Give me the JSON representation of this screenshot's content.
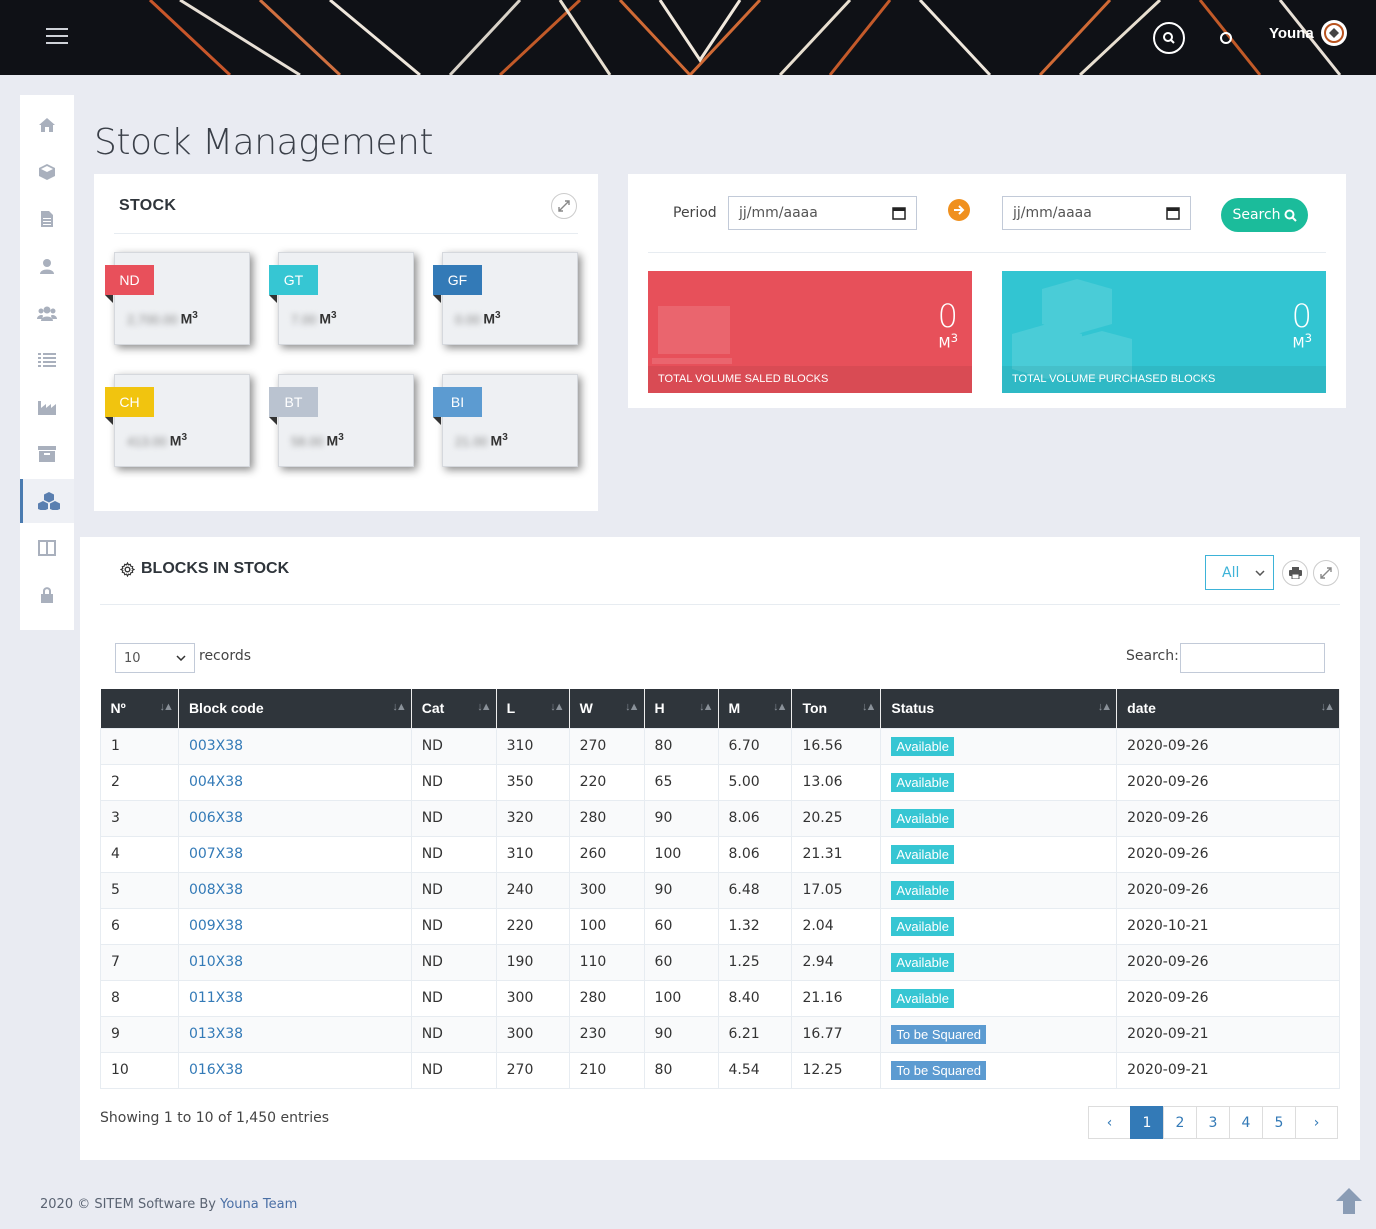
{
  "header": {
    "user_name": "Youna"
  },
  "sidebar": {
    "items": [
      {
        "icon": "home-icon"
      },
      {
        "icon": "cube-icon"
      },
      {
        "icon": "document-icon"
      },
      {
        "icon": "user-icon"
      },
      {
        "icon": "users-icon"
      },
      {
        "icon": "list-icon"
      },
      {
        "icon": "factory-icon"
      },
      {
        "icon": "archive-icon"
      },
      {
        "icon": "cubes-icon",
        "active": true
      },
      {
        "icon": "columns-icon"
      },
      {
        "icon": "lock-icon"
      }
    ]
  },
  "page_title": "Stock Management",
  "stock": {
    "title": "STOCK",
    "unit": "M",
    "cards": [
      {
        "code": "ND",
        "color": "#e8505b",
        "value": "2,700.00"
      },
      {
        "code": "GT",
        "color": "#36c6d3",
        "value": "7.00"
      },
      {
        "code": "GF",
        "color": "#337ab7",
        "value": "0.00"
      },
      {
        "code": "CH",
        "color": "#f1c40f",
        "value": "413.00"
      },
      {
        "code": "BT",
        "color": "#bac3d0",
        "value": "58.00"
      },
      {
        "code": "BI",
        "color": "#5c9bd1",
        "value": "21.00"
      }
    ]
  },
  "period": {
    "label": "Period",
    "from_placeholder": "jj/mm/aaaa",
    "to_placeholder": "jj/mm/aaaa",
    "search_label": "Search"
  },
  "stats": {
    "saled": {
      "value": "0",
      "unit": "M",
      "label": "TOTAL VOLUME SALED BLOCKS",
      "color": "#e7505a"
    },
    "purchased": {
      "value": "0",
      "unit": "M",
      "label": "TOTAL VOLUME PURCHASED BLOCKS",
      "color": "#32c5d2"
    }
  },
  "blocks": {
    "title": "BLOCKS IN STOCK",
    "filter_value": "All",
    "records_value": "10",
    "records_label": "records",
    "search_label": "Search:",
    "columns": [
      "Nº",
      "Block code",
      "Cat",
      "L",
      "W",
      "H",
      "M",
      "Ton",
      "Status",
      "date"
    ],
    "rows": [
      [
        "1",
        "003X38",
        "ND",
        "310",
        "270",
        "80",
        "6.70",
        "16.56",
        "Available",
        "2020-09-26"
      ],
      [
        "2",
        "004X38",
        "ND",
        "350",
        "220",
        "65",
        "5.00",
        "13.06",
        "Available",
        "2020-09-26"
      ],
      [
        "3",
        "006X38",
        "ND",
        "320",
        "280",
        "90",
        "8.06",
        "20.25",
        "Available",
        "2020-09-26"
      ],
      [
        "4",
        "007X38",
        "ND",
        "310",
        "260",
        "100",
        "8.06",
        "21.31",
        "Available",
        "2020-09-26"
      ],
      [
        "5",
        "008X38",
        "ND",
        "240",
        "300",
        "90",
        "6.48",
        "17.05",
        "Available",
        "2020-09-26"
      ],
      [
        "6",
        "009X38",
        "ND",
        "220",
        "100",
        "60",
        "1.32",
        "2.04",
        "Available",
        "2020-10-21"
      ],
      [
        "7",
        "010X38",
        "ND",
        "190",
        "110",
        "60",
        "1.25",
        "2.94",
        "Available",
        "2020-09-26"
      ],
      [
        "8",
        "011X38",
        "ND",
        "300",
        "280",
        "100",
        "8.40",
        "21.16",
        "Available",
        "2020-09-26"
      ],
      [
        "9",
        "013X38",
        "ND",
        "300",
        "230",
        "90",
        "6.21",
        "16.77",
        "To be Squared",
        "2020-09-21"
      ],
      [
        "10",
        "016X38",
        "ND",
        "270",
        "210",
        "80",
        "4.54",
        "12.25",
        "To be Squared",
        "2020-09-21"
      ]
    ],
    "status_colors": {
      "Available": "#36c6d3",
      "To be Squared": "#5c9bd1"
    },
    "showing": "Showing 1 to 10 of 1,450 entries",
    "pages": [
      "‹",
      "1",
      "2",
      "3",
      "4",
      "5",
      "›"
    ],
    "active_page": "1"
  },
  "footer": {
    "text": "2020 © SITEM Software By ",
    "link": "Youna Team"
  }
}
